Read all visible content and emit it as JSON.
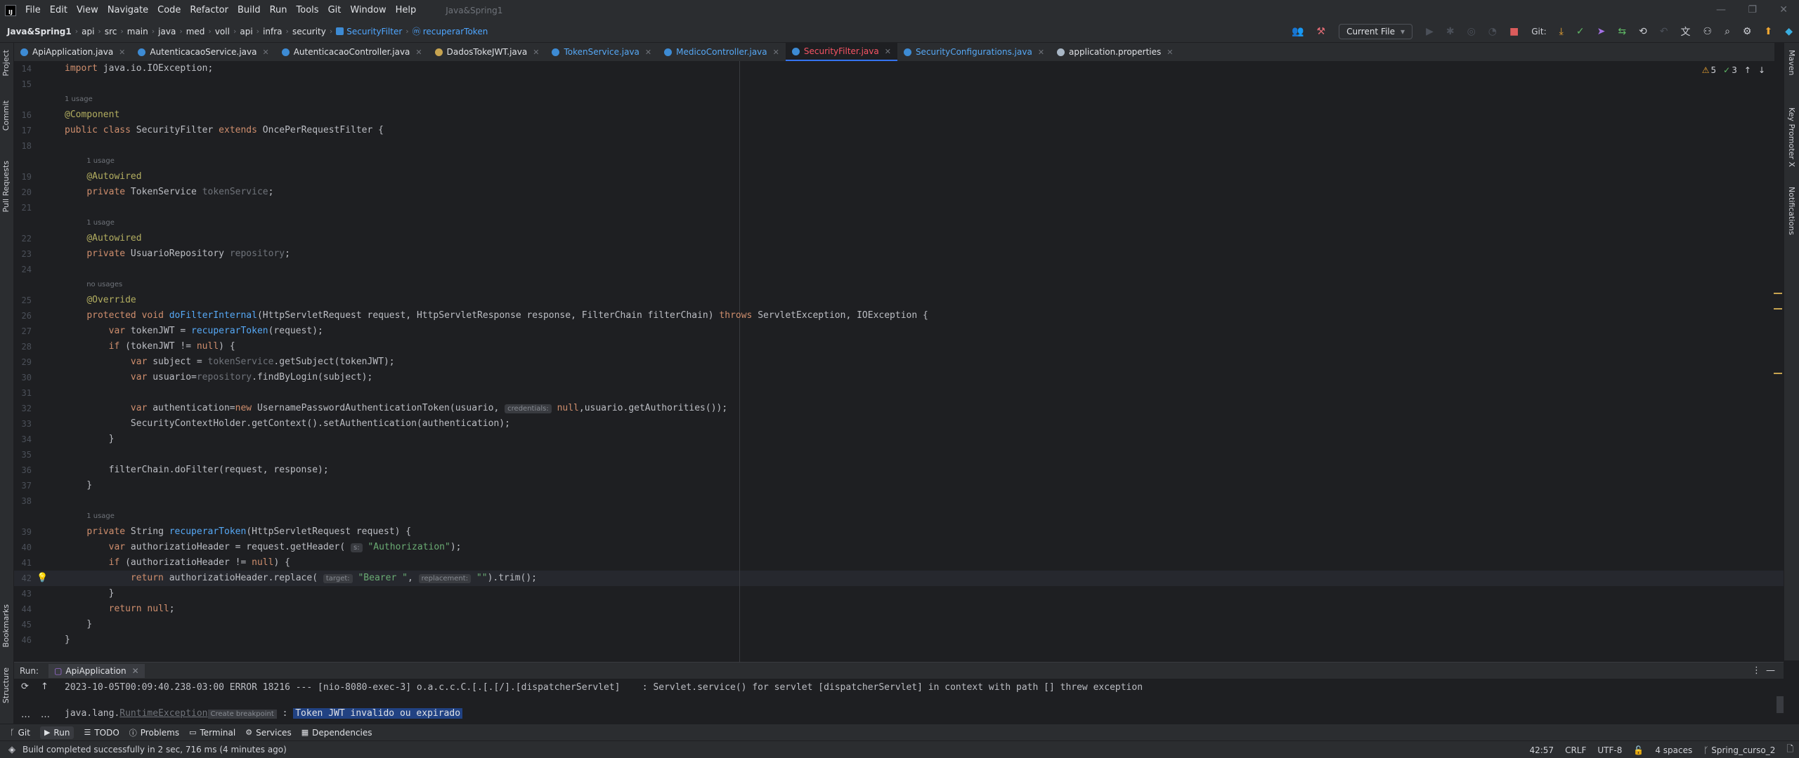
{
  "menu": {
    "items": [
      "File",
      "Edit",
      "View",
      "Navigate",
      "Code",
      "Refactor",
      "Build",
      "Run",
      "Tools",
      "Git",
      "Window",
      "Help"
    ],
    "window_title": "Java&Spring1"
  },
  "breadcrumb": {
    "project": "Java&Spring1",
    "items": [
      "api",
      "src",
      "main",
      "java",
      "med",
      "voll",
      "api",
      "infra",
      "security"
    ],
    "class": "SecurityFilter",
    "method": "recuperarToken"
  },
  "toolbar": {
    "run_config": "Current File",
    "git_label": "Git:"
  },
  "tabs": [
    {
      "label": "ApiApplication.java",
      "color": "#3d8bd4",
      "active": false,
      "error": false
    },
    {
      "label": "AutenticacaoService.java",
      "color": "#3d8bd4",
      "active": false,
      "error": false
    },
    {
      "label": "AutenticacaoController.java",
      "color": "#3d8bd4",
      "active": false,
      "error": false
    },
    {
      "label": "DadosTokeJWT.java",
      "color": "#c7a450",
      "active": false,
      "error": false
    },
    {
      "label": "TokenService.java",
      "color": "#3d8bd4",
      "active": false,
      "error": true
    },
    {
      "label": "MedicoController.java",
      "color": "#3d8bd4",
      "active": false,
      "error": true
    },
    {
      "label": "SecurityFilter.java",
      "color": "#3d8bd4",
      "active": true,
      "error": true
    },
    {
      "label": "SecurityConfigurations.java",
      "color": "#3d8bd4",
      "active": false,
      "error": true
    },
    {
      "label": "application.properties",
      "color": "#a9b7c6",
      "active": false,
      "error": false
    }
  ],
  "left_strip": [
    "Project",
    "Commit",
    "Pull Requests",
    "Bookmarks",
    "Structure"
  ],
  "right_strip": [
    "Maven",
    "Key Promoter X",
    "Notifications"
  ],
  "inspections": {
    "warnings": "5",
    "typos": "3"
  },
  "code": {
    "lines": [
      {
        "n": "14",
        "text": "import java.io.IOException;"
      },
      {
        "n": "15",
        "text": ""
      },
      {
        "n": "16",
        "hint": "1 usage",
        "text": "@Component"
      },
      {
        "n": "17",
        "text": "public class SecurityFilter extends OncePerRequestFilter {"
      },
      {
        "n": "18",
        "text": ""
      },
      {
        "n": "19",
        "hint": "1 usage",
        "text": "    @Autowired"
      },
      {
        "n": "20",
        "text": "    private TokenService tokenService;"
      },
      {
        "n": "21",
        "text": ""
      },
      {
        "n": "22",
        "hint": "1 usage",
        "text": "    @Autowired"
      },
      {
        "n": "23",
        "text": "    private UsuarioRepository repository;"
      },
      {
        "n": "24",
        "text": ""
      },
      {
        "n": "25",
        "hint": "no usages",
        "text": "    @Override"
      },
      {
        "n": "26",
        "text": "    protected void doFilterInternal(HttpServletRequest request, HttpServletResponse response, FilterChain filterChain) throws ServletException, IOException {"
      },
      {
        "n": "27",
        "text": "        var tokenJWT = recuperarToken(request);"
      },
      {
        "n": "28",
        "text": "        if (tokenJWT != null) {"
      },
      {
        "n": "29",
        "text": "            var subject = tokenService.getSubject(tokenJWT);"
      },
      {
        "n": "30",
        "text": "            var usuario=repository.findByLogin(subject);"
      },
      {
        "n": "31",
        "text": ""
      },
      {
        "n": "32",
        "text": "            var authentication=new UsernamePasswordAuthenticationToken(usuario, credentials: null,usuario.getAuthorities());"
      },
      {
        "n": "33",
        "text": "            SecurityContextHolder.getContext().setAuthentication(authentication);"
      },
      {
        "n": "34",
        "text": "        }"
      },
      {
        "n": "35",
        "text": ""
      },
      {
        "n": "36",
        "text": "        filterChain.doFilter(request, response);"
      },
      {
        "n": "37",
        "text": "    }"
      },
      {
        "n": "38",
        "text": ""
      },
      {
        "n": "39",
        "hint": "1 usage",
        "text": "    private String recuperarToken(HttpServletRequest request) {"
      },
      {
        "n": "40",
        "text": "        var authorizatioHeader = request.getHeader( s: \"Authorization\");"
      },
      {
        "n": "41",
        "text": "        if (authorizatioHeader != null) {"
      },
      {
        "n": "42",
        "text": "            return authorizatioHeader.replace( target: \"Bearer \", replacement: \"\").trim();"
      },
      {
        "n": "43",
        "text": "        }"
      },
      {
        "n": "44",
        "text": "        return null;"
      },
      {
        "n": "45",
        "text": "    }"
      },
      {
        "n": "46",
        "text": "}"
      }
    ]
  },
  "run_panel": {
    "label": "Run:",
    "tab": "ApiApplication",
    "console_line1": "2023-10-05T00:09:40.238-03:00 ERROR 18216 --- [nio-8080-exec-3] o.a.c.c.C.[.[.[/].[dispatcherServlet]    : Servlet.service() for servlet [dispatcherServlet] in context with path [] threw exception",
    "exc_prefix": "java.lang.",
    "exc_class": "RuntimeException",
    "create_breakpoint": "Create breakpoint",
    "exc_sep": " : ",
    "exc_message": "Token JWT invalido ou expirado"
  },
  "tool_tabs": [
    {
      "label": "Git",
      "icon": "ᚴ"
    },
    {
      "label": "Run",
      "icon": "▶"
    },
    {
      "label": "TODO",
      "icon": "☰"
    },
    {
      "label": "Problems",
      "icon": "ⓘ"
    },
    {
      "label": "Terminal",
      "icon": "▭"
    },
    {
      "label": "Services",
      "icon": "⚙"
    },
    {
      "label": "Dependencies",
      "icon": "▦"
    }
  ],
  "status": {
    "message": "Build completed successfully in 2 sec, 716 ms (4 minutes ago)",
    "position": "42:57",
    "line_sep": "CRLF",
    "encoding": "UTF-8",
    "indent": "4 spaces",
    "branch": "Spring_curso_2"
  }
}
